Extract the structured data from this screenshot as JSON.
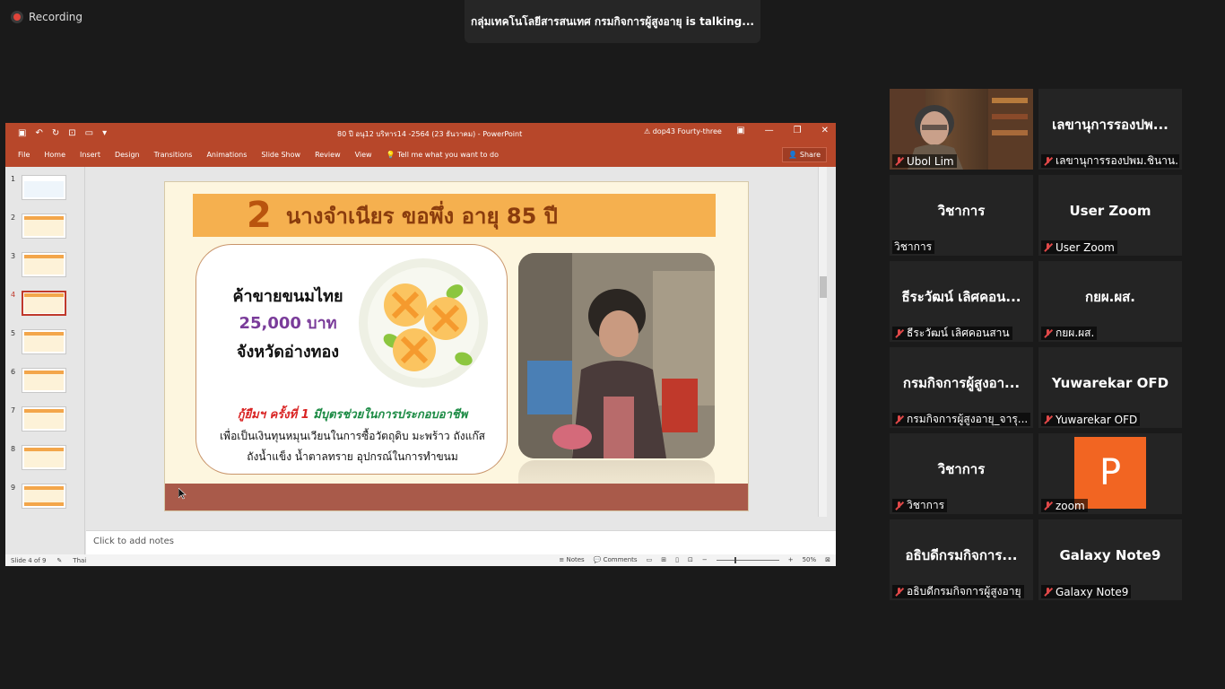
{
  "zoom": {
    "recording_label": "Recording",
    "talking_text": "กลุ่มเทคโนโลยีสารสนเทศ กรมกิจการผู้สูงอายุ is  talking..."
  },
  "ppt": {
    "title": "80 ปี อนุ12 บริหาร14 -2564 (23 ธันวาคม)  -  PowerPoint",
    "warning_user": "dop43 Fourty-three",
    "tabs": [
      "File",
      "Home",
      "Insert",
      "Design",
      "Transitions",
      "Animations",
      "Slide Show",
      "Review",
      "View",
      "Tell me what you want to do"
    ],
    "share_label": "Share",
    "notes_placeholder": "Click to add notes",
    "status": {
      "slide_info": "Slide 4 of 9",
      "language": "Thai",
      "notes": "Notes",
      "comments": "Comments",
      "zoom": "50%"
    },
    "thumbnails": [
      "1",
      "2",
      "3",
      "4",
      "5",
      "6",
      "7",
      "8",
      "9"
    ],
    "active_slide": 4
  },
  "slide": {
    "number": "2",
    "name": "นางจำเนียร  ขอพึ่ง  อายุ 85 ปี",
    "line1": "ค้าขายขนมไทย",
    "line2": "25,000 บาท",
    "line3": "จังหวัดอ่างทอง",
    "loan_red": "กู้ยืมฯ ครั้งที่ 1",
    "loan_green": " มีบุตรช่วยในการประกอบอาชีพ",
    "desc1": "เพื่อเป็นเงินทุนหมุนเวียนในการซื้อวัตถุดิบ มะพร้าว ถังแก๊ส",
    "desc2": "ถังน้ำแข็ง น้ำตาลทราย อุปกรณ์ในการทำขนม"
  },
  "participants": [
    {
      "display": "",
      "label": "Ubol Lim",
      "video": true
    },
    {
      "display": "เลขานุการรองปพ...",
      "label": "เลขานุการรองปพม.ชินาน..."
    },
    {
      "display": "วิชาการ",
      "label": "วิชาการ"
    },
    {
      "display": "User Zoom",
      "label": "User Zoom"
    },
    {
      "display": "ธีระวัฒน์ เลิศคอน...",
      "label": "ธีระวัฒน์ เลิศคอนสาน"
    },
    {
      "display": "กยผ.ผส.",
      "label": "กยผ.ผส."
    },
    {
      "display": "กรมกิจการผู้สูงอา...",
      "label": "กรมกิจการผู้สูงอายุ_จารุ..."
    },
    {
      "display": "Yuwarekar OFD",
      "label": "Yuwarekar OFD"
    },
    {
      "display": "วิชาการ",
      "label": "วิชาการ"
    },
    {
      "display": "P",
      "label": "zoom",
      "avatar": true
    },
    {
      "display": "อธิบดีกรมกิจการ...",
      "label": "อธิบดีกรมกิจการผู้สูงอายุ"
    },
    {
      "display": "Galaxy Note9",
      "label": "Galaxy Note9"
    }
  ],
  "colors": {
    "ppt_accent": "#b7472a",
    "avatar_orange": "#f26522",
    "muted_red": "#e04848"
  }
}
